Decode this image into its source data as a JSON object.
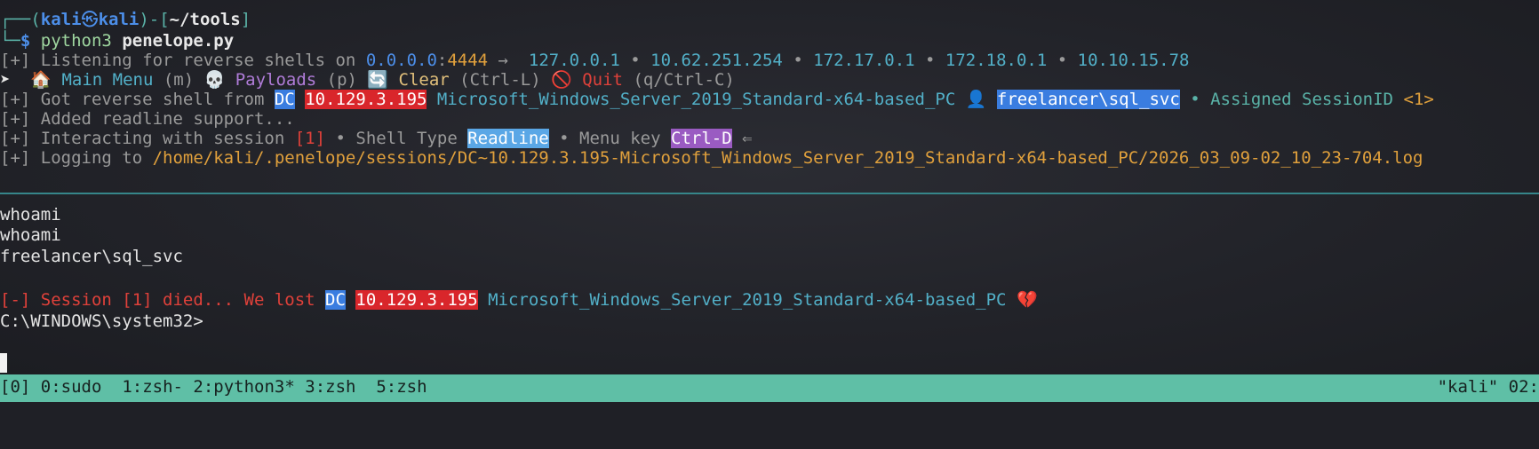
{
  "prompt": {
    "corner_top": "┌──",
    "open_paren": "(",
    "user": "kali",
    "at_icon": "㉿",
    "host": "kali",
    "close_bracket": ")-[",
    "path": "~/tools",
    "end_bracket": "]",
    "corner_bottom": "└─",
    "dollar": "$ ",
    "cmd": "python3",
    "arg": "penelope.py"
  },
  "listening": {
    "prefix": "[+] Listening for reverse shells on ",
    "bind_ip": "0.0.0.0",
    "colon": ":",
    "port": "4444",
    "arrow": " →  ",
    "ips": [
      "127.0.0.1",
      "10.62.251.254",
      "172.17.0.1",
      "172.18.0.1",
      "10.10.15.78"
    ],
    "sep": " • "
  },
  "menu": {
    "bullet": "➤  ",
    "home_icon": "🏠",
    "main_label": " Main Menu",
    "main_key": " (m) ",
    "skull_icon": "💀",
    "payloads_label": " Payloads",
    "payloads_key": " (p) ",
    "refresh_icon": "🔄",
    "clear_label": " Clear",
    "clear_key": " (Ctrl-L) ",
    "no_icon": "🚫",
    "quit_label": " Quit",
    "quit_key": " (q/Ctrl-C)"
  },
  "got_shell": {
    "prefix": "[+] Got reverse shell from ",
    "host": "DC",
    "ip": "10.129.3.195",
    "os": " Microsoft_Windows_Server_2019_Standard-x64-based_PC ",
    "user_icon": "👤",
    "user": "freelancer\\sql_svc",
    "assigned": " • Assigned SessionID ",
    "session_id": "<1>"
  },
  "readline": {
    "text": "[+] Added readline support..."
  },
  "interacting": {
    "prefix": "[+] Interacting with session ",
    "session": "[1]",
    "shell_type_label": " • Shell Type ",
    "shell_type": "Readline",
    "menu_key_label": " • Menu key ",
    "menu_key": "Ctrl-D",
    "arrow": " ⇐"
  },
  "logging": {
    "prefix": "[+] Logging to ",
    "path": "/home/kali/.penelope/sessions/DC~10.129.3.195-Microsoft_Windows_Server_2019_Standard-x64-based_PC/2026_03_09-02_10_23-704.log"
  },
  "session_output": {
    "line1": "whoami",
    "line2": "whoami",
    "line3": "freelancer\\sql_svc"
  },
  "died": {
    "prefix": "[-] Session [1] died... We lost ",
    "host": "DC",
    "ip": "10.129.3.195",
    "os": " Microsoft_Windows_Server_2019_Standard-x64-based_PC ",
    "broken_icon": "💔"
  },
  "cmd_prompt": {
    "text": "C:\\WINDOWS\\system32>"
  },
  "tmux": {
    "session": "[0]",
    "windows": [
      {
        "label": "0:sudo"
      },
      {
        "label": "1:zsh-"
      },
      {
        "label": "2:python3*"
      },
      {
        "label": "3:zsh"
      },
      {
        "label": "5:zsh"
      }
    ],
    "right": "\"kali\" 02:"
  },
  "colors": {
    "status_bg": "#5fbfa6",
    "highlight_blue": "#3a7de0",
    "highlight_red": "#d9262b",
    "highlight_purple": "#9a5bc2"
  }
}
